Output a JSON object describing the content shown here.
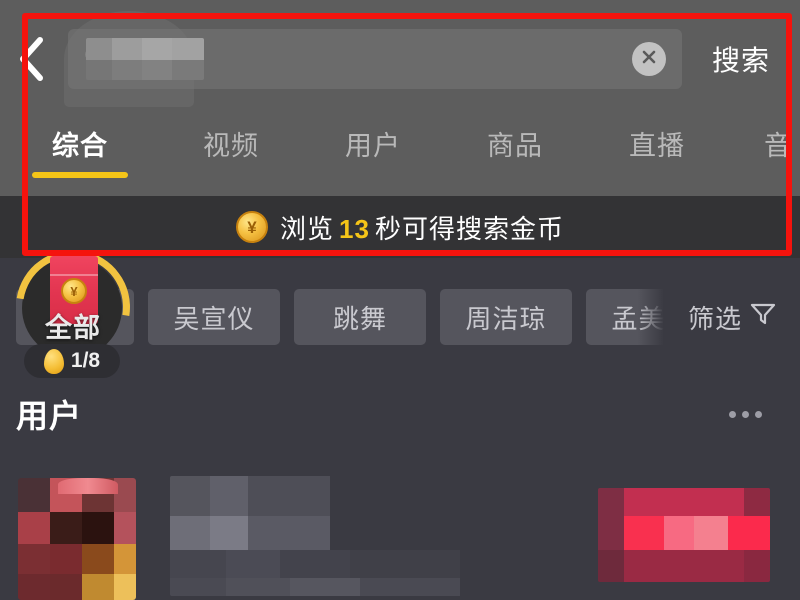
{
  "app": {
    "name": "douyin-search",
    "theme": {
      "top_bar_bg": "#5d5d5d",
      "banner_bg": "#333335",
      "content_bg": "#3a3a42",
      "accent_yellow": "#f5c518",
      "annotation_red": "#f5130d",
      "chip_bg": "#55555d"
    }
  },
  "search": {
    "back_icon": "chevron-left-icon",
    "search_icon": "search-icon",
    "value": "",
    "placeholder": "",
    "value_censored": true,
    "clear_icon": "close-icon",
    "submit_label": "搜索"
  },
  "tabs": {
    "active_index": 0,
    "items": [
      {
        "label": "综合",
        "active": true
      },
      {
        "label": "视频",
        "active": false
      },
      {
        "label": "用户",
        "active": false
      },
      {
        "label": "商品",
        "active": false
      },
      {
        "label": "直播",
        "active": false
      },
      {
        "label": "音",
        "active": false
      }
    ]
  },
  "coin_banner": {
    "icon": "gold-coin-icon",
    "icon_glyph": "¥",
    "text_before": "浏览",
    "seconds": "13",
    "text_after": "秒可得搜索金币"
  },
  "chips": {
    "items": [
      {
        "label": "全部",
        "selected": true
      },
      {
        "label": "吴宣仪",
        "selected": false
      },
      {
        "label": "跳舞",
        "selected": false
      },
      {
        "label": "周洁琼",
        "selected": false
      },
      {
        "label": "孟美岐",
        "selected": false
      }
    ],
    "filter": {
      "label": "筛选",
      "icon": "funnel-icon"
    }
  },
  "envelope_widget": {
    "icon": "red-envelope-icon",
    "coin_glyph": "¥",
    "label": "全部",
    "badge_icon": "gold-egg-icon",
    "badge_text": "1/8",
    "progress_current": 1,
    "progress_total": 8
  },
  "section": {
    "title": "用户",
    "more_icon": "more-horizontal-icon"
  },
  "result": {
    "censored": true,
    "avatar": "blurred-avatar",
    "name": "blurred-username",
    "thumbnail": "blurred-thumbnail"
  },
  "annotation": {
    "type": "highlight-rectangle",
    "color": "#f5130d"
  }
}
